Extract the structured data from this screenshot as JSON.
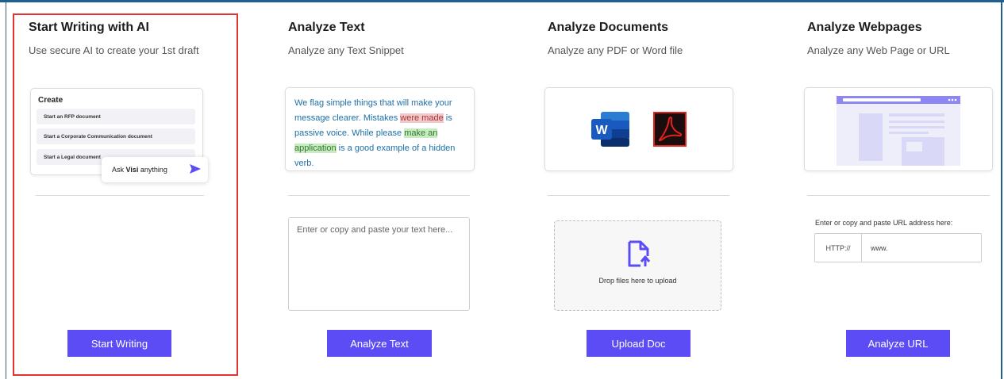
{
  "columns": {
    "writing": {
      "title": "Start Writing with AI",
      "subtitle": "Use secure AI to create your 1st draft",
      "create_title": "Create",
      "create_items": [
        "Start an RFP document",
        "Start a Corporate Communication document",
        "Start a Legal document"
      ],
      "ask_prefix": "Ask ",
      "ask_brand": "Visi",
      "ask_suffix": " anything",
      "button": "Start Writing"
    },
    "text": {
      "title": "Analyze Text",
      "subtitle": "Analyze any Text Snippet",
      "sample_part1": "We flag simple things that will make your message clearer. Mistakes ",
      "sample_hl1": "were made",
      "sample_part2": " is passive voice. While please ",
      "sample_hl2a": "make an",
      "sample_hl2b": "application",
      "sample_part3": " is a good example of a hidden verb.",
      "textarea_placeholder": "Enter or copy and paste your text here...",
      "button": "Analyze Text"
    },
    "documents": {
      "title": "Analyze Documents",
      "subtitle": "Analyze any PDF or Word file",
      "word_letter": "W",
      "drop_text": "Drop files here to upload",
      "button": "Upload Doc"
    },
    "webpages": {
      "title": "Analyze Webpages",
      "subtitle": "Analyze any Web Page or URL",
      "url_label": "Enter or copy and paste URL address here:",
      "url_prefix": "HTTP://",
      "url_placeholder": "www.",
      "button": "Analyze URL"
    }
  },
  "colors": {
    "accent": "#5b4cf5",
    "highlight_border": "#e33333",
    "frame": "#1f5f8f"
  },
  "icons": [
    "send-icon",
    "word-icon",
    "pdf-icon",
    "file-upload-icon",
    "webpage-illustration"
  ]
}
